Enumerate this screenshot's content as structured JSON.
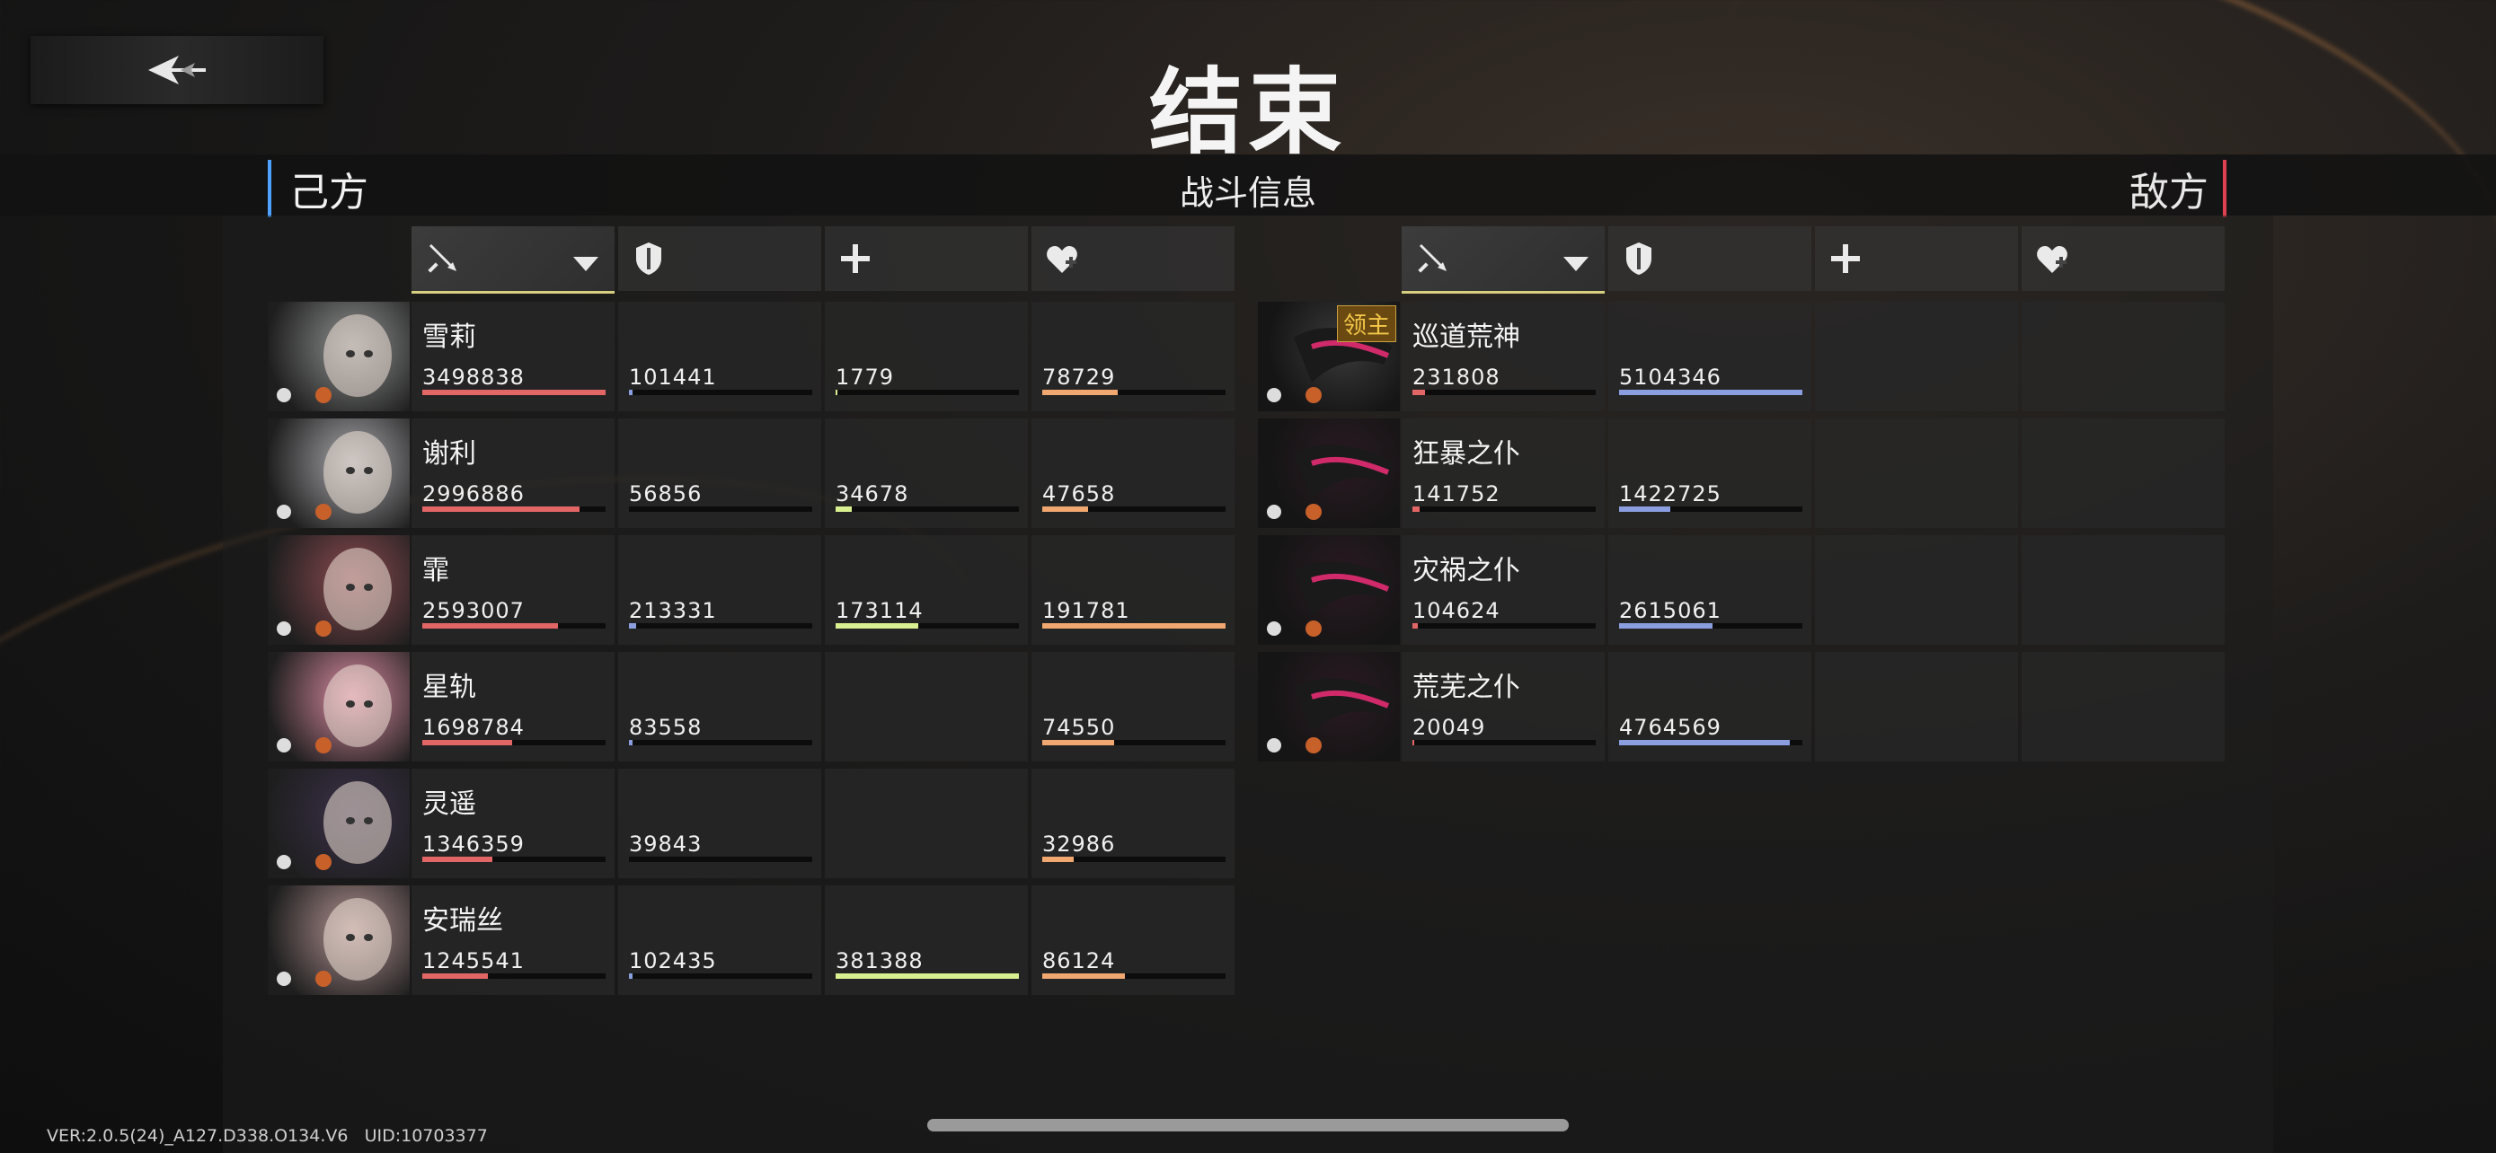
{
  "header": {
    "title": "结束",
    "subtitle": "战斗信息",
    "left_side": "己方",
    "right_side": "敌方"
  },
  "footer": {
    "version": "VER:2.0.5(24)_A127.D338.O134.V6",
    "uid": "UID:10703377"
  },
  "columns": [
    "sword-icon",
    "shield-icon",
    "plus-icon",
    "heart-plus-icon"
  ],
  "allies": [
    {
      "name": "雪莉",
      "dmg": "3498838",
      "def": "101441",
      "heal": "1779",
      "hp": "78729",
      "dmg_f": 1.0,
      "def_f": 0.02,
      "heal_f": 0.01,
      "hp_f": 0.41,
      "hue": "#8f9090"
    },
    {
      "name": "谢利",
      "dmg": "2996886",
      "def": "56856",
      "heal": "34678",
      "hp": "47658",
      "dmg_f": 0.86,
      "def_f": 0.0,
      "heal_f": 0.09,
      "hp_f": 0.25,
      "hue": "#a8a8ac"
    },
    {
      "name": "霏",
      "dmg": "2593007",
      "def": "213331",
      "heal": "173114",
      "hp": "191781",
      "dmg_f": 0.74,
      "def_f": 0.04,
      "heal_f": 0.45,
      "hp_f": 1.0,
      "hue": "#8a4a50"
    },
    {
      "name": "星轨",
      "dmg": "1698784",
      "def": "83558",
      "heal": "",
      "hp": "74550",
      "dmg_f": 0.49,
      "def_f": 0.02,
      "heal_f": 0.0,
      "hp_f": 0.39,
      "hue": "#d88aa0"
    },
    {
      "name": "灵遥",
      "dmg": "1346359",
      "def": "39843",
      "heal": "",
      "hp": "32986",
      "dmg_f": 0.38,
      "def_f": 0.0,
      "heal_f": 0.0,
      "hp_f": 0.17,
      "hue": "#3a3048"
    },
    {
      "name": "安瑞丝",
      "dmg": "1245541",
      "def": "102435",
      "heal": "381388",
      "hp": "86124",
      "dmg_f": 0.36,
      "def_f": 0.02,
      "heal_f": 1.0,
      "hp_f": 0.45,
      "hue": "#b09090"
    }
  ],
  "enemies": [
    {
      "name": "巡道荒神",
      "dmg": "231808",
      "def": "5104346",
      "dmg_f": 0.07,
      "def_f": 1.0,
      "boss": "领主",
      "hue": "#3a3a3a"
    },
    {
      "name": "狂暴之仆",
      "dmg": "141752",
      "def": "1422725",
      "dmg_f": 0.04,
      "def_f": 0.28,
      "hue": "#2a1a22"
    },
    {
      "name": "灾祸之仆",
      "dmg": "104624",
      "def": "2615061",
      "dmg_f": 0.03,
      "def_f": 0.51,
      "hue": "#2a1a22"
    },
    {
      "name": "荒芜之仆",
      "dmg": "20049",
      "def": "4764569",
      "dmg_f": 0.01,
      "def_f": 0.93,
      "hue": "#2a1a22"
    }
  ],
  "colors": {
    "accent_left": "#4da3ff",
    "accent_right": "#e0404f",
    "dmg": "#e36666",
    "def": "#8a9ee0",
    "heal": "#d8f090",
    "hp": "#f0a870"
  }
}
